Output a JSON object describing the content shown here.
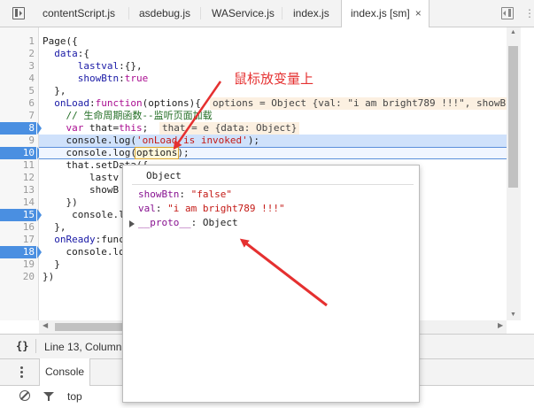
{
  "tabs": [
    {
      "label": "contentScript.js",
      "active": false
    },
    {
      "label": "asdebug.js",
      "active": false
    },
    {
      "label": "WAService.js",
      "active": false
    },
    {
      "label": "index.js",
      "active": false
    },
    {
      "label": "index.js [sm]",
      "active": true
    }
  ],
  "tab_close": "×",
  "right_more": "⋮",
  "lines": [
    "1",
    "2",
    "3",
    "4",
    "5",
    "6",
    "7",
    "8",
    "9",
    "10",
    "11",
    "12",
    "13",
    "14",
    "15",
    "16",
    "17",
    "18",
    "19",
    "20"
  ],
  "breakpoint_lines": [
    "8",
    "10",
    "15",
    "18"
  ],
  "code": {
    "l1": "Page({",
    "l2a": "  ",
    "l2b": "data",
    "l2c": ":{",
    "l3a": "      ",
    "l3b": "lastval",
    "l3c": ":{},",
    "l4a": "      ",
    "l4b": "showBtn",
    "l4c": ":",
    "l4d": "true",
    "l5": "  },",
    "l6a": "  ",
    "l6b": "onLoad",
    "l6c": ":",
    "l6d": "function",
    "l6e": "(options){",
    "l7": "    // 生命周期函数--监听页面加载",
    "l8a": "    ",
    "l8b": "var",
    "l8c": " that=",
    "l8d": "this",
    "l8e": ";",
    "l9a": "    console.log(",
    "l9b": "'onLoad is invoked'",
    "l9c": ");",
    "l10a": "    console.log(",
    "l10b": "options",
    "l10c": ");",
    "l11": "    that.setData({",
    "l12": "        lastv",
    "l13": "        showB",
    "l14": "    })",
    "l15": "     console.l",
    "l16": "  },",
    "l17a": "  ",
    "l17b": "onReady",
    "l17c": ":func",
    "l18": "    console.lo",
    "l19": "  }",
    "l20": "})"
  },
  "inline_values": {
    "options": "options = Object {val: \"i am bright789 !!!\", showB",
    "that": "that = e {data: Object}"
  },
  "popover": {
    "title": "Object",
    "rows": [
      {
        "key": "showBtn",
        "sep": ": ",
        "value": "\"false\""
      },
      {
        "key": "val",
        "sep": ": ",
        "value": "\"i am bright789 !!!\""
      },
      {
        "key": "__proto__",
        "sep": ": ",
        "value": "Object"
      }
    ]
  },
  "annotation": "鼠标放变量上",
  "status": {
    "braces": "{}",
    "position": "Line 13, Column"
  },
  "drawer": {
    "tab_label": "Console",
    "context": "top"
  },
  "colors": {
    "breakpoint": "#4a8fe1",
    "annotation": "#e53030",
    "string": "#c41a16",
    "keyword": "#aa0d91"
  }
}
